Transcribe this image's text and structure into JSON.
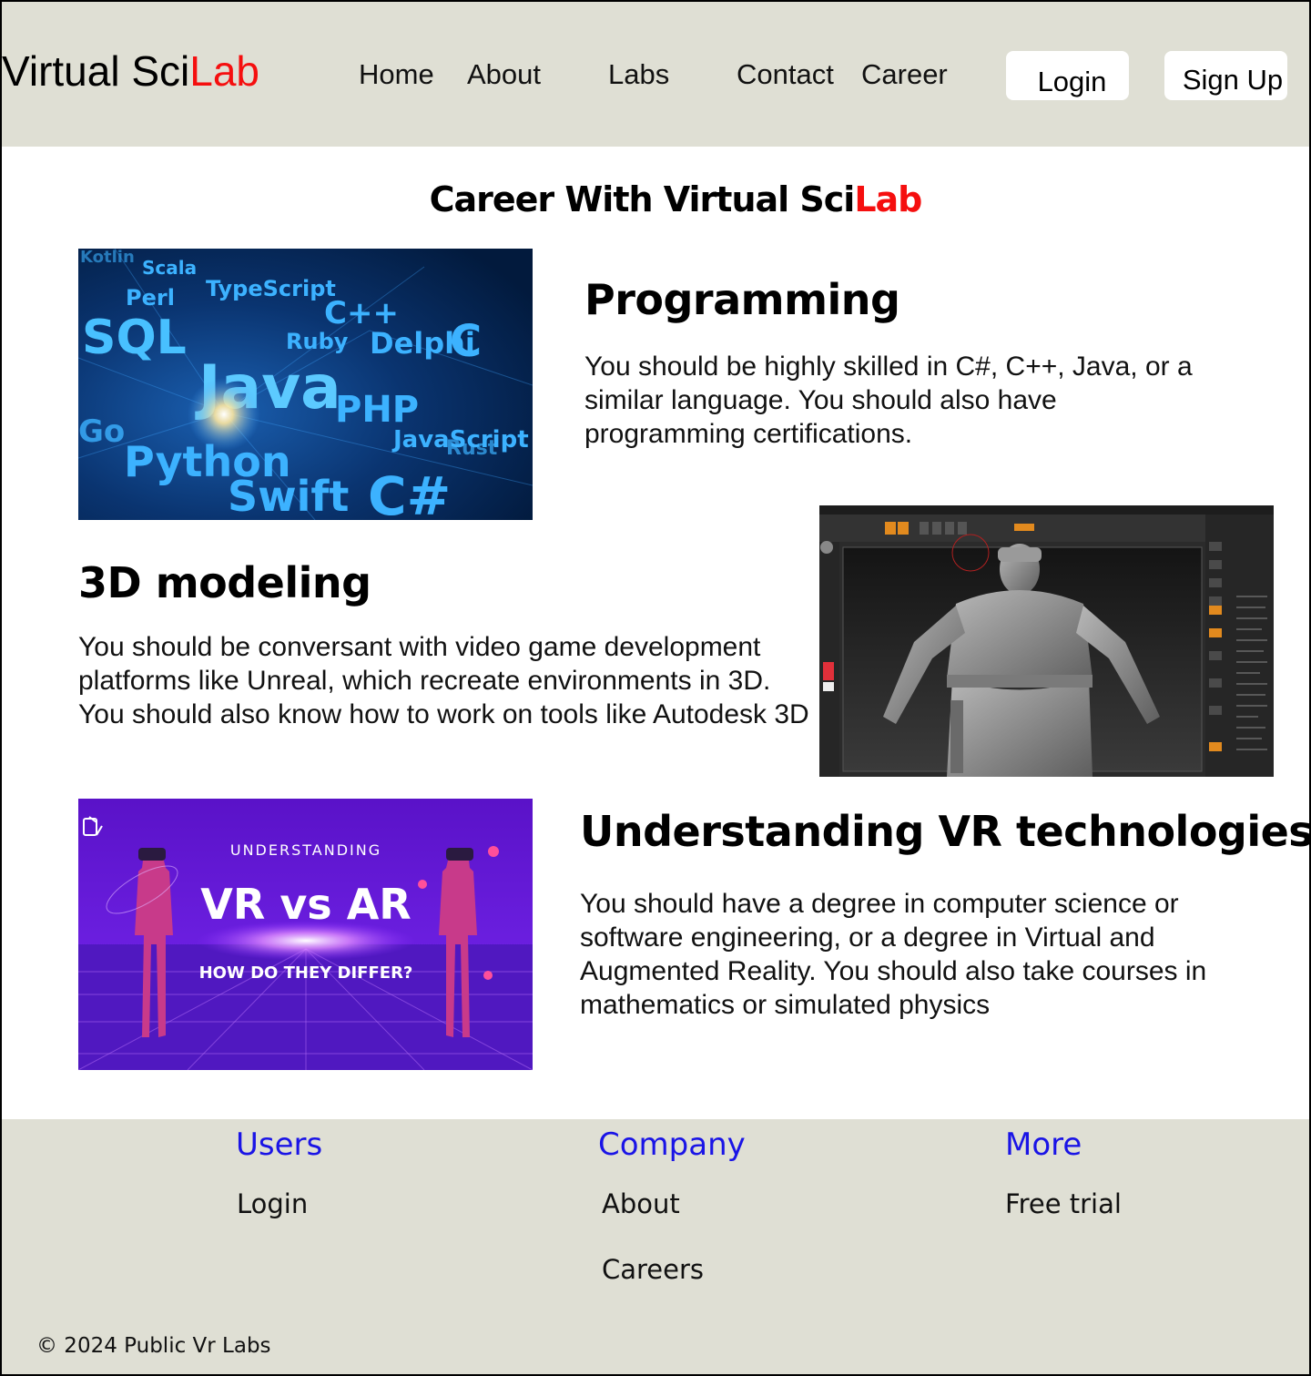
{
  "header": {
    "logo_main": "Virtual Sci",
    "logo_accent": "Lab",
    "nav": [
      "Home",
      "About",
      "Labs",
      "Contact",
      "Career"
    ],
    "login_label": "Login",
    "signup_label": "Sign Up"
  },
  "page": {
    "title_main": "Career With Virtual Sci",
    "title_accent": "Lab"
  },
  "sections": [
    {
      "heading": "Programming",
      "text": "You should be highly skilled in C#, C++, Java, or a similar language. You should also have programming certifications.",
      "image_words": [
        "Scala",
        "Perl",
        "TypeScript",
        "SQL",
        "C++",
        "Ruby",
        "Delphi",
        "Java",
        "C",
        "PHP",
        "Python",
        "JavaScript",
        "Swift",
        "C#",
        "Go",
        "Rust",
        "Kotlin"
      ]
    },
    {
      "heading": "3D modeling",
      "text": "You should be conversant with video game development platforms like  Unreal, which recreate environments in 3D. You should also know how to work on tools like Autodesk 3D"
    },
    {
      "heading": "Understanding VR technologies",
      "text": "You should have a degree in computer science or software engineering, or a degree in Virtual and Augmented Reality. You should also take courses in mathematics or simulated physics",
      "image_text": {
        "top": "UNDERSTANDING",
        "main": "VR vs AR",
        "sub": "HOW DO THEY DIFFER?"
      }
    }
  ],
  "footer": {
    "columns": [
      {
        "title": "Users",
        "links": [
          "Login"
        ]
      },
      {
        "title": "Company",
        "links": [
          "About",
          "Careers"
        ]
      },
      {
        "title": "More",
        "links": [
          "Free trial"
        ]
      }
    ],
    "copyright": "© 2024 Public Vr Labs"
  },
  "colors": {
    "header_bg": "#dfdfd4",
    "accent_red": "#f50f0f",
    "footer_title_blue": "#1a14e6"
  }
}
